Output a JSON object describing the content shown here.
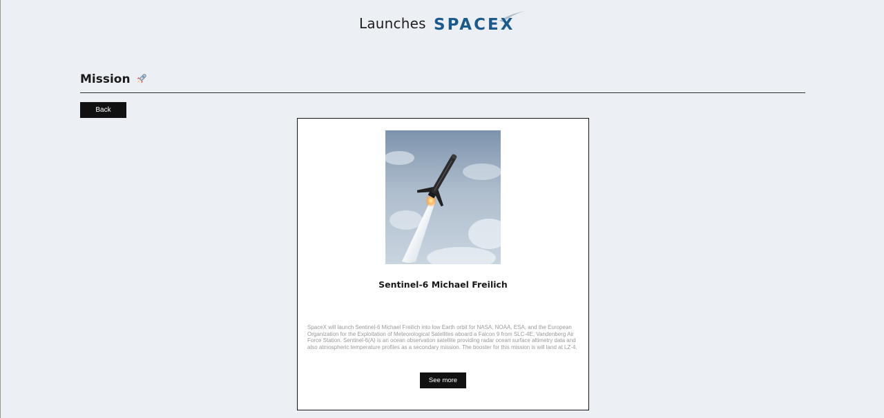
{
  "header": {
    "title": "Launches",
    "logo_text": "SPACEX",
    "logo_icon": "spacex-logo",
    "logo_color": "#1c5a8c"
  },
  "section": {
    "title": "Mission",
    "icon": "rocket-icon"
  },
  "back_button_label": "Back",
  "mission": {
    "image_icon": "rocket-launch-photo",
    "name": "Sentinel-6 Michael Freilich",
    "description": "SpaceX will launch Sentinel-6 Michael Freilich into low Earth orbit for NASA, NOAA, ESA, and the European Organization for the Exploitation of Meteorological Satellites aboard a Falcon 9 from SLC-4E, Vandenberg Air Force Station. Sentinel-6(A) is an ocean observation satellite providing radar ocean surface altimetry data and also atmospheric temperature profiles as a secondary mission. The booster for this mission is will land at LZ-4.",
    "see_more_label": "See more"
  },
  "colors": {
    "background": "#eceff4",
    "button_bg": "#111111",
    "description_text": "#9a9a9a"
  }
}
